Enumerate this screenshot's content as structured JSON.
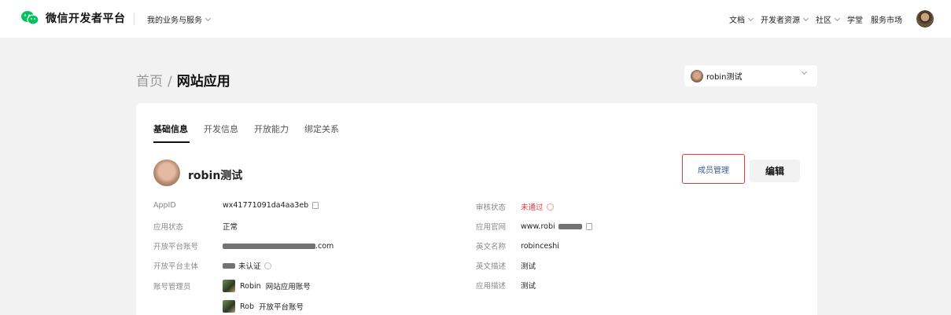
{
  "header": {
    "brand": "微信开发者平台",
    "my_business": "我的业务与服务",
    "nav": [
      "文档",
      "开发者资源",
      "社区",
      "学堂",
      "服务市场"
    ]
  },
  "breadcrumb": {
    "home": "首页",
    "sep": "/",
    "current": "网站应用"
  },
  "app_selector": {
    "value": "robin测试"
  },
  "tabs": [
    "基础信息",
    "开发信息",
    "开放能力",
    "绑定关系"
  ],
  "app": {
    "name": "robin测试"
  },
  "buttons": {
    "member": "成员管理",
    "edit": "编辑"
  },
  "left_info": [
    {
      "label": "AppID",
      "value": "wx41771091da4aa3eb"
    },
    {
      "label": "应用状态",
      "value": "正常"
    },
    {
      "label": "开放平台账号",
      "value": ".com"
    },
    {
      "label": "开放平台主体",
      "value": "未认证"
    },
    {
      "label": "账号管理员",
      "value": "网站应用账号"
    }
  ],
  "admin2": {
    "name": "Rob",
    "value": "开放平台账号"
  },
  "admin1_name": "Robin",
  "right_info": [
    {
      "label": "审核状态",
      "value": "未通过"
    },
    {
      "label": "应用官网",
      "value": "www.robi"
    },
    {
      "label": "英文名称",
      "value": "robinceshi"
    },
    {
      "label": "英文描述",
      "value": "测试"
    },
    {
      "label": "应用描述",
      "value": "测试"
    }
  ],
  "colors": {
    "alert": "#e53935",
    "link": "#3a5d8f",
    "wechat_green": "#07c160"
  }
}
